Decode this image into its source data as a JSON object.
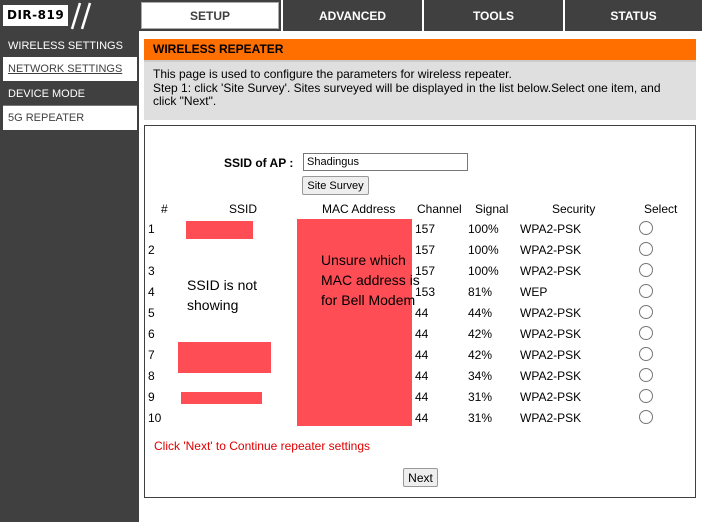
{
  "header": {
    "logo": "DIR-819",
    "tabs": [
      "SETUP",
      "ADVANCED",
      "TOOLS",
      "STATUS"
    ],
    "active_tab": "SETUP"
  },
  "sidebar": {
    "items": [
      {
        "label": "WIRELESS SETTINGS"
      },
      {
        "label": "NETWORK SETTINGS"
      },
      {
        "label": "DEVICE MODE"
      },
      {
        "label": "5G REPEATER"
      }
    ]
  },
  "page": {
    "title": "WIRELESS REPEATER",
    "description_1": "This page is used to configure the parameters for wireless repeater.",
    "description_2": "Step 1: click 'Site Survey'. Sites surveyed will be displayed in the list below.Select one item, and click \"Next\"."
  },
  "form": {
    "ssid_label": "SSID of AP :",
    "ssid_value": "Shadingus",
    "survey_button": "Site Survey"
  },
  "table": {
    "headers": [
      "#",
      "SSID",
      "MAC Address",
      "Channel",
      "Signal",
      "Security",
      "Select"
    ],
    "rows": [
      {
        "num": "1",
        "channel": "157",
        "signal": "100%",
        "security": "WPA2-PSK"
      },
      {
        "num": "2",
        "channel": "157",
        "signal": "100%",
        "security": "WPA2-PSK"
      },
      {
        "num": "3",
        "channel": "157",
        "signal": "100%",
        "security": "WPA2-PSK"
      },
      {
        "num": "4",
        "channel": "153",
        "signal": "81%",
        "security": "WEP"
      },
      {
        "num": "5",
        "channel": "44",
        "signal": "44%",
        "security": "WPA2-PSK"
      },
      {
        "num": "6",
        "channel": "44",
        "signal": "42%",
        "security": "WPA2-PSK"
      },
      {
        "num": "7",
        "channel": "44",
        "signal": "42%",
        "security": "WPA2-PSK"
      },
      {
        "num": "8",
        "channel": "44",
        "signal": "34%",
        "security": "WPA2-PSK"
      },
      {
        "num": "9",
        "channel": "44",
        "signal": "31%",
        "security": "WPA2-PSK"
      },
      {
        "num": "10",
        "channel": "44",
        "signal": "31%",
        "security": "WPA2-PSK"
      }
    ]
  },
  "annotations": {
    "ssid_note": "SSID is not showing",
    "mac_note": "Unsure which MAC address is for Bell Modem"
  },
  "footer": {
    "continue_message": "Click 'Next' to Continue repeater settings",
    "next_button": "Next"
  },
  "colors": {
    "header_bg": "#404040",
    "title_bar": "#ff6f00",
    "redaction": "#ff4d55",
    "continue_text": "#e00000"
  }
}
